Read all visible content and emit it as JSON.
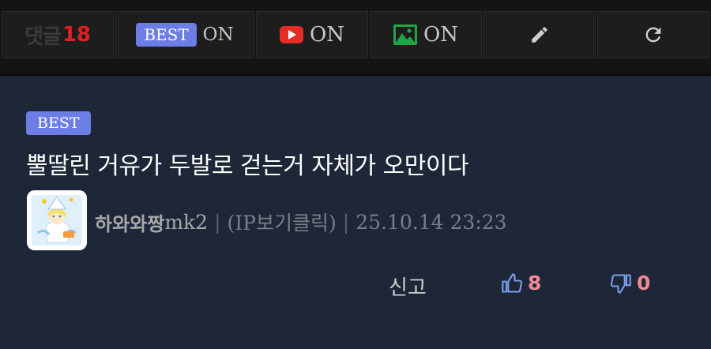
{
  "toolbar": {
    "comments_label": "댓글",
    "comments_count": "18",
    "best_chip": "BEST",
    "best_state": "ON",
    "video_state": "ON",
    "image_state": "ON",
    "icons": [
      "youtube-icon",
      "image-icon",
      "pencil-icon",
      "refresh-icon"
    ]
  },
  "comment": {
    "badge": "BEST",
    "text": "뿔딸린 거유가 두발로 걷는거 자체가 오만이다",
    "author_name": "하와와짱",
    "author_suffix": "mk2",
    "separator": "|",
    "ip_label": "(IP보기클릭)",
    "date": "25.10.14 23:23",
    "report_label": "신고",
    "upvotes": "8",
    "downvotes": "0"
  },
  "colors": {
    "background": "#1d2737",
    "toolbar": "#141414",
    "best_badge": "#6c7ee6",
    "comment_count": "#e02020",
    "vote_count": "#f08a94",
    "youtube": "#e52d27",
    "image": "#21a447",
    "thumb_icon": "#7b9eea"
  }
}
